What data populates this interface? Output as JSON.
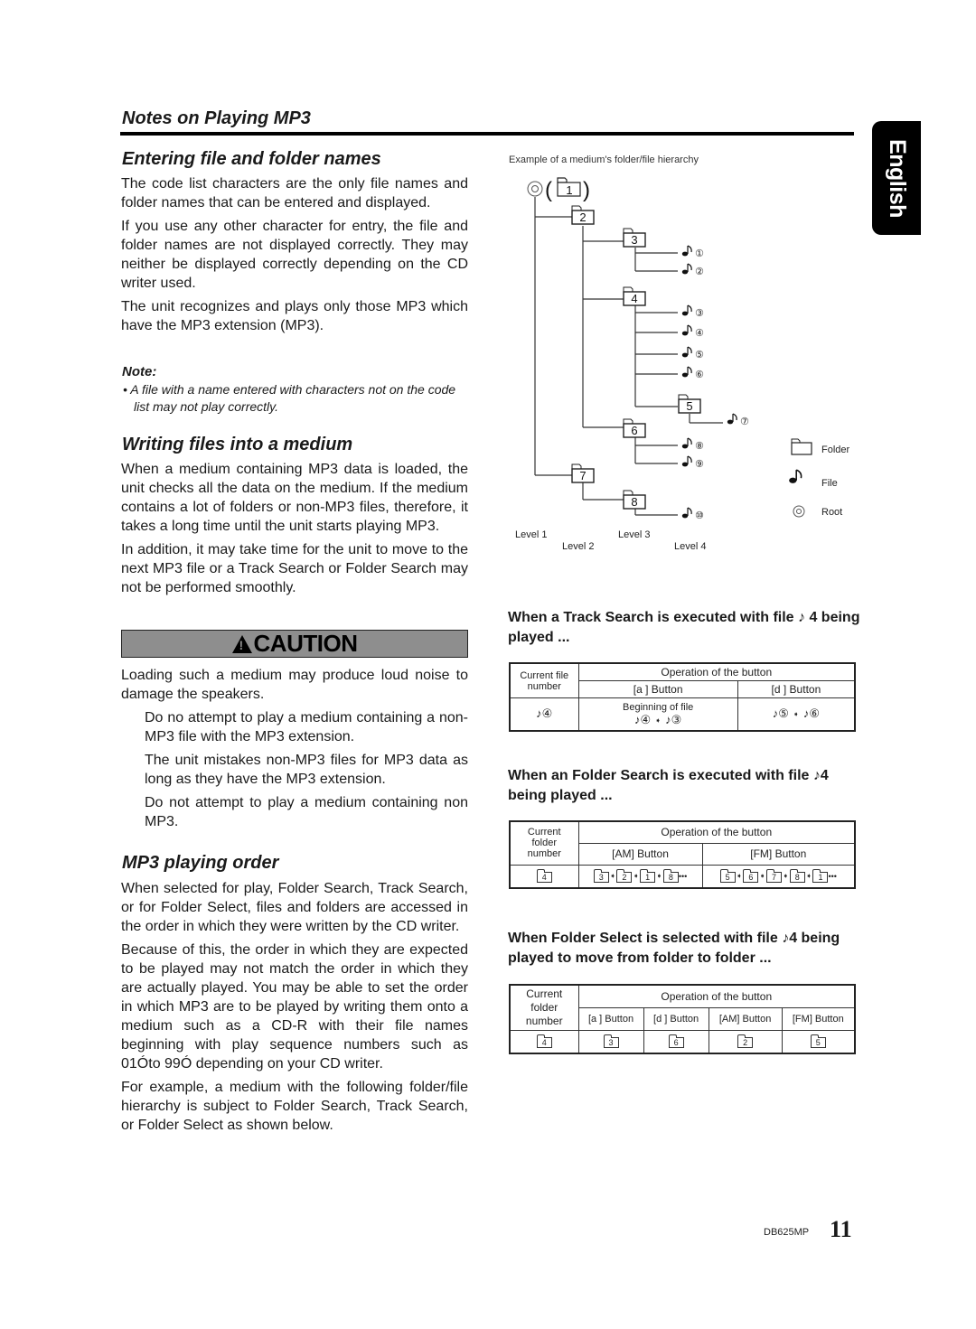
{
  "side_tab": {
    "label": "English"
  },
  "section_title": "Notes on Playing MP3",
  "left_column": {
    "entering": {
      "heading": "Entering file and folder names",
      "paragraphs": [
        "The code list characters are the only file names and folder names that can be entered and displayed.",
        "If you use any other character for entry, the file and folder names are not displayed correctly. They may neither be displayed correctly depending on the CD writer used.",
        "The unit recognizes and plays only those MP3 which have the MP3 extension (MP3)."
      ],
      "note_label": "Note:",
      "note_text": "• A file with a name entered with characters not on the code list may not play correctly."
    },
    "writing": {
      "heading": "Writing files into a medium",
      "paragraphs": [
        "When a medium containing MP3 data is loaded, the unit checks all the data on the medium. If the medium contains a lot of folders or non-MP3 files, therefore, it takes a long time until the unit starts playing MP3.",
        "In addition, it may take time for the unit to move to the next MP3 file or a Track Search or Folder Search may not be performed smoothly."
      ]
    },
    "caution": {
      "label": "CAUTION",
      "text": "Loading such a medium may produce loud noise to damage the speakers.",
      "items": [
        "Do no attempt to play a medium containing a non-MP3 file with the MP3 extension.",
        "The unit mistakes non-MP3 files for MP3 data as long as they have the MP3 extension.",
        "Do not attempt to play a medium containing non MP3."
      ]
    },
    "order": {
      "heading": "MP3 playing order",
      "paragraphs": [
        "When selected for play, Folder Search, Track Search, or for Folder Select, files and folders are accessed in the order in which they were written by the CD writer.",
        "Because of this, the order in which they are expected to be played may not match the order in which they are actually played. You may be able to set the order in which MP3 are to be played by writing them onto a medium such as a CD-R with their file names beginning with play sequence numbers such as  01Óto  99Ó depending on your CD writer.",
        "For example, a medium with the following folder/file hierarchy is subject to Folder Search, Track Search, or Folder Select as shown below."
      ]
    }
  },
  "diagram": {
    "caption": "Example of a medium's folder/file hierarchy",
    "root_folder": "1",
    "folders": [
      "2",
      "3",
      "4",
      "5",
      "6",
      "7",
      "8"
    ],
    "files": [
      "①",
      "②",
      "③",
      "④",
      "⑤",
      "⑥",
      "⑦",
      "⑧",
      "⑨",
      "⑩"
    ],
    "levels": [
      "Level 1",
      "Level 2",
      "Level 3",
      "Level 4"
    ],
    "legend": [
      {
        "icon": "folder-icon",
        "label": "Folder"
      },
      {
        "icon": "file-icon",
        "label": "File"
      },
      {
        "icon": "root-icon",
        "label": "Root"
      }
    ]
  },
  "track_search": {
    "heading": "When a Track Search is executed with file ♪ 4   being played ...",
    "header_current": "Current file number",
    "header_operation": "Operation of the button",
    "col_a": "[a   ] Button",
    "col_d": "[d   ] Button",
    "current": "♪④",
    "a_line1": "Beginning of file",
    "a_from": "♪④",
    "a_to": "♪③",
    "d_from": "♪⑤",
    "d_to": "♪⑥"
  },
  "folder_search": {
    "heading": "When an Folder Search is executed with file ♪4   being played ...",
    "header_current": "Current folder number",
    "header_operation": "Operation of the button",
    "col_am": "[AM] Button",
    "col_fm": "[FM] Button",
    "current": "4",
    "am_sequence": [
      "3",
      "2",
      "1",
      "8"
    ],
    "fm_sequence": [
      "5",
      "6",
      "7",
      "8",
      "1"
    ],
    "ellipsis": "•••"
  },
  "folder_select": {
    "heading": "When Folder Select is selected with file ♪4 being played to move from folder to folder ...",
    "header_current": "Current folder number",
    "header_operation": "Operation of the button",
    "col_a": "[a   ] Button",
    "col_d": "[d   ] Button",
    "col_am": "[AM] Button",
    "col_fm": "[FM] Button",
    "current": "4",
    "a_result": "3",
    "d_result": "6",
    "am_result": "2",
    "fm_result": "5"
  },
  "footer": {
    "model": "DB625MP",
    "page": "11"
  }
}
